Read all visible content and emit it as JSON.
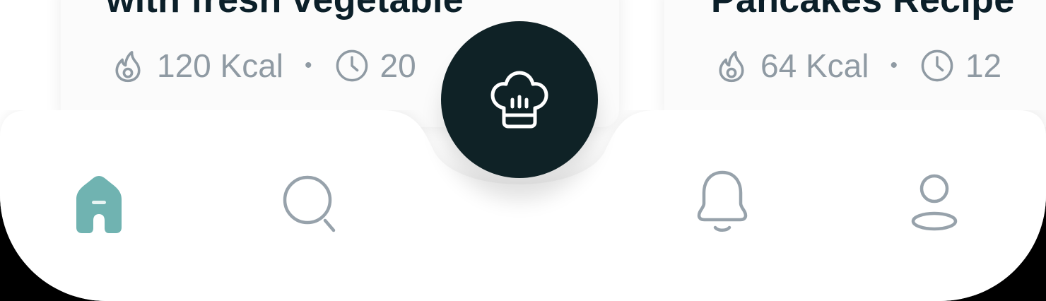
{
  "cards": [
    {
      "title": "with fresh vegetable",
      "calories": "120 Kcal",
      "time": "20",
      "calories_icon": "flame-icon",
      "time_icon": "clock-icon"
    },
    {
      "title": "Pancakes Recipe",
      "calories": "64 Kcal",
      "time": "12",
      "calories_icon": "flame-icon",
      "time_icon": "clock-icon"
    }
  ],
  "meta_separator": "•",
  "nav": {
    "items": [
      {
        "name": "home",
        "icon": "home-icon",
        "active": true
      },
      {
        "name": "search",
        "icon": "search-icon",
        "active": false
      },
      {
        "name": "notifications",
        "icon": "bell-icon",
        "active": false
      },
      {
        "name": "profile",
        "icon": "user-icon",
        "active": false
      }
    ],
    "fab_icon": "chef-hat-icon"
  },
  "colors": {
    "active": "#70b3b1",
    "inactive": "#97a2ab",
    "fab": "#0f2226",
    "title": "#0b1f29"
  }
}
